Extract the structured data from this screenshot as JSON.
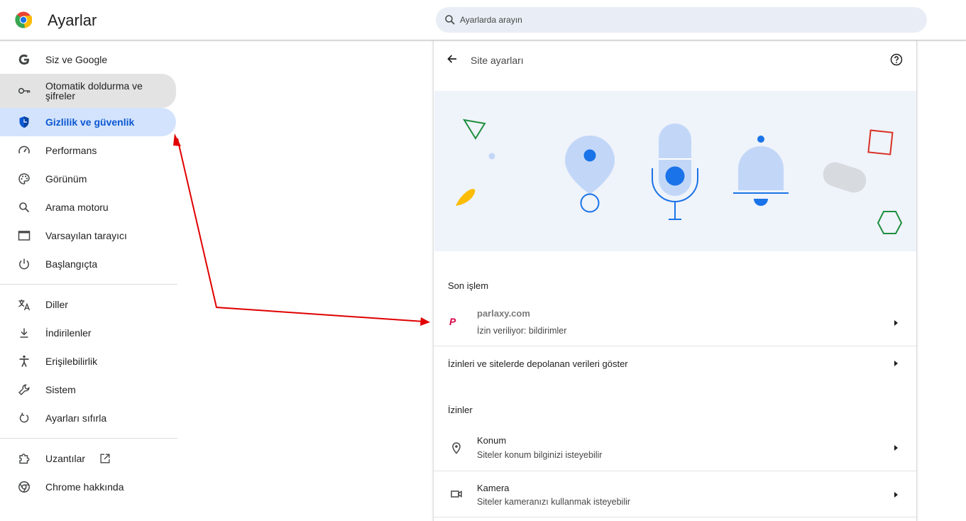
{
  "header": {
    "title": "Ayarlar",
    "search_placeholder": "Ayarlarda arayın"
  },
  "sidebar": {
    "items": [
      {
        "label": "Siz ve Google",
        "icon": "google-g-icon"
      },
      {
        "label": "Otomatik doldurma ve şifreler",
        "icon": "key-icon"
      },
      {
        "label": "Gizlilik ve güvenlik",
        "icon": "shield-icon"
      },
      {
        "label": "Performans",
        "icon": "speedometer-icon"
      },
      {
        "label": "Görünüm",
        "icon": "palette-icon"
      },
      {
        "label": "Arama motoru",
        "icon": "search-icon"
      },
      {
        "label": "Varsayılan tarayıcı",
        "icon": "browser-window-icon"
      },
      {
        "label": "Başlangıçta",
        "icon": "power-icon"
      },
      {
        "label": "Diller",
        "icon": "translate-icon"
      },
      {
        "label": "İndirilenler",
        "icon": "download-icon"
      },
      {
        "label": "Erişilebilirlik",
        "icon": "accessibility-icon"
      },
      {
        "label": "Sistem",
        "icon": "wrench-icon"
      },
      {
        "label": "Ayarları sıfırla",
        "icon": "reset-icon"
      },
      {
        "label": "Uzantılar",
        "icon": "extension-puzzle-icon"
      },
      {
        "label": "Chrome hakkında",
        "icon": "chrome-icon"
      }
    ],
    "active_index": 2,
    "hover_index": 1
  },
  "content": {
    "title": "Site ayarları",
    "recent_activity": {
      "heading": "Son işlem",
      "site": "parlaxy.com",
      "status": "İzin veriliyor: bildirimler",
      "site_badge": "P"
    },
    "show_all_link": "İzinleri ve sitelerde depolanan verileri göster",
    "permissions": {
      "heading": "İzinler",
      "items": [
        {
          "title": "Konum",
          "subtitle": "Siteler konum bilginizi isteyebilir",
          "icon": "location-pin-icon"
        },
        {
          "title": "Kamera",
          "subtitle": "Siteler kameranızı kullanmak isteyebilir",
          "icon": "video-camera-icon"
        }
      ]
    }
  },
  "colors": {
    "accent": "#0b57d0",
    "active_bg": "#d3e3fd",
    "hover_bg": "#e3e3e3",
    "illustration_bg": "#eff3fa",
    "annotation_arrow": "#e00000"
  }
}
